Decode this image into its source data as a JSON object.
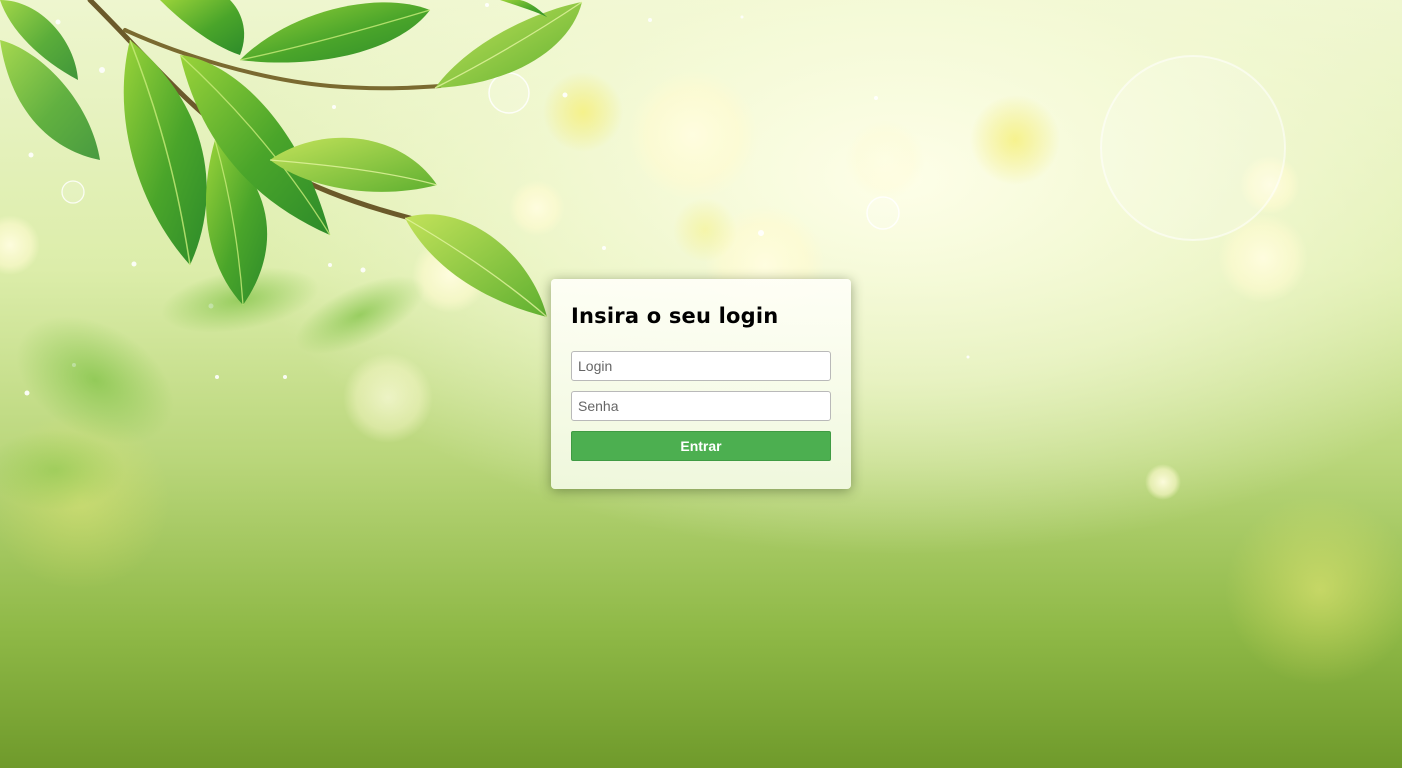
{
  "login": {
    "title": "Insira o seu login",
    "username_placeholder": "Login",
    "password_placeholder": "Senha",
    "submit_label": "Entrar"
  },
  "colors": {
    "submit_button": "#4caf50",
    "background_top": "#eef6cf",
    "background_bottom": "#6f9a2b"
  }
}
